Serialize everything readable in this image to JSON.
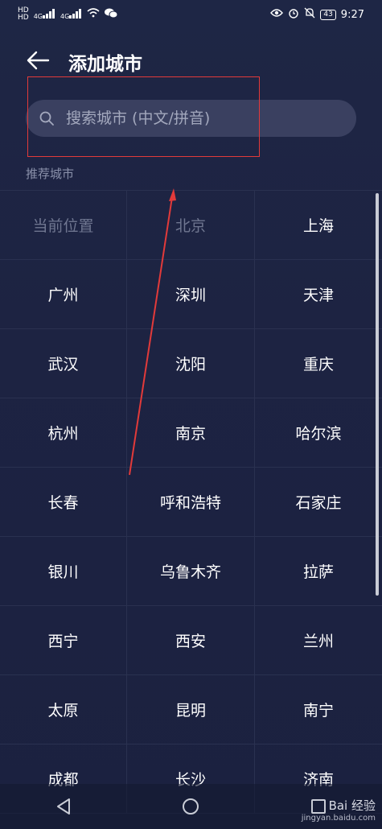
{
  "status_bar": {
    "time": "9:27",
    "battery": "43",
    "network_left_1": "HD",
    "network_left_2": "HD",
    "signal_label_1": "4G",
    "signal_label_2": "4G"
  },
  "header": {
    "title": "添加城市"
  },
  "search": {
    "placeholder": "搜索城市 (中文/拼音)"
  },
  "section_label": "推荐城市",
  "cities": [
    {
      "name": "当前位置",
      "dim": true
    },
    {
      "name": "北京",
      "dim": true
    },
    {
      "name": "上海",
      "dim": false
    },
    {
      "name": "广州",
      "dim": false
    },
    {
      "name": "深圳",
      "dim": false
    },
    {
      "name": "天津",
      "dim": false
    },
    {
      "name": "武汉",
      "dim": false
    },
    {
      "name": "沈阳",
      "dim": false
    },
    {
      "name": "重庆",
      "dim": false
    },
    {
      "name": "杭州",
      "dim": false
    },
    {
      "name": "南京",
      "dim": false
    },
    {
      "name": "哈尔滨",
      "dim": false
    },
    {
      "name": "长春",
      "dim": false
    },
    {
      "name": "呼和浩特",
      "dim": false
    },
    {
      "name": "石家庄",
      "dim": false
    },
    {
      "name": "银川",
      "dim": false
    },
    {
      "name": "乌鲁木齐",
      "dim": false
    },
    {
      "name": "拉萨",
      "dim": false
    },
    {
      "name": "西宁",
      "dim": false
    },
    {
      "name": "西安",
      "dim": false
    },
    {
      "name": "兰州",
      "dim": false
    },
    {
      "name": "太原",
      "dim": false
    },
    {
      "name": "昆明",
      "dim": false
    },
    {
      "name": "南宁",
      "dim": false
    },
    {
      "name": "成都",
      "dim": false
    },
    {
      "name": "长沙",
      "dim": false
    },
    {
      "name": "济南",
      "dim": false
    }
  ],
  "watermark": {
    "brand": "Bai 经验",
    "url": "jingyan.baidu.com"
  },
  "colors": {
    "annotation_red": "#e23a3a"
  }
}
